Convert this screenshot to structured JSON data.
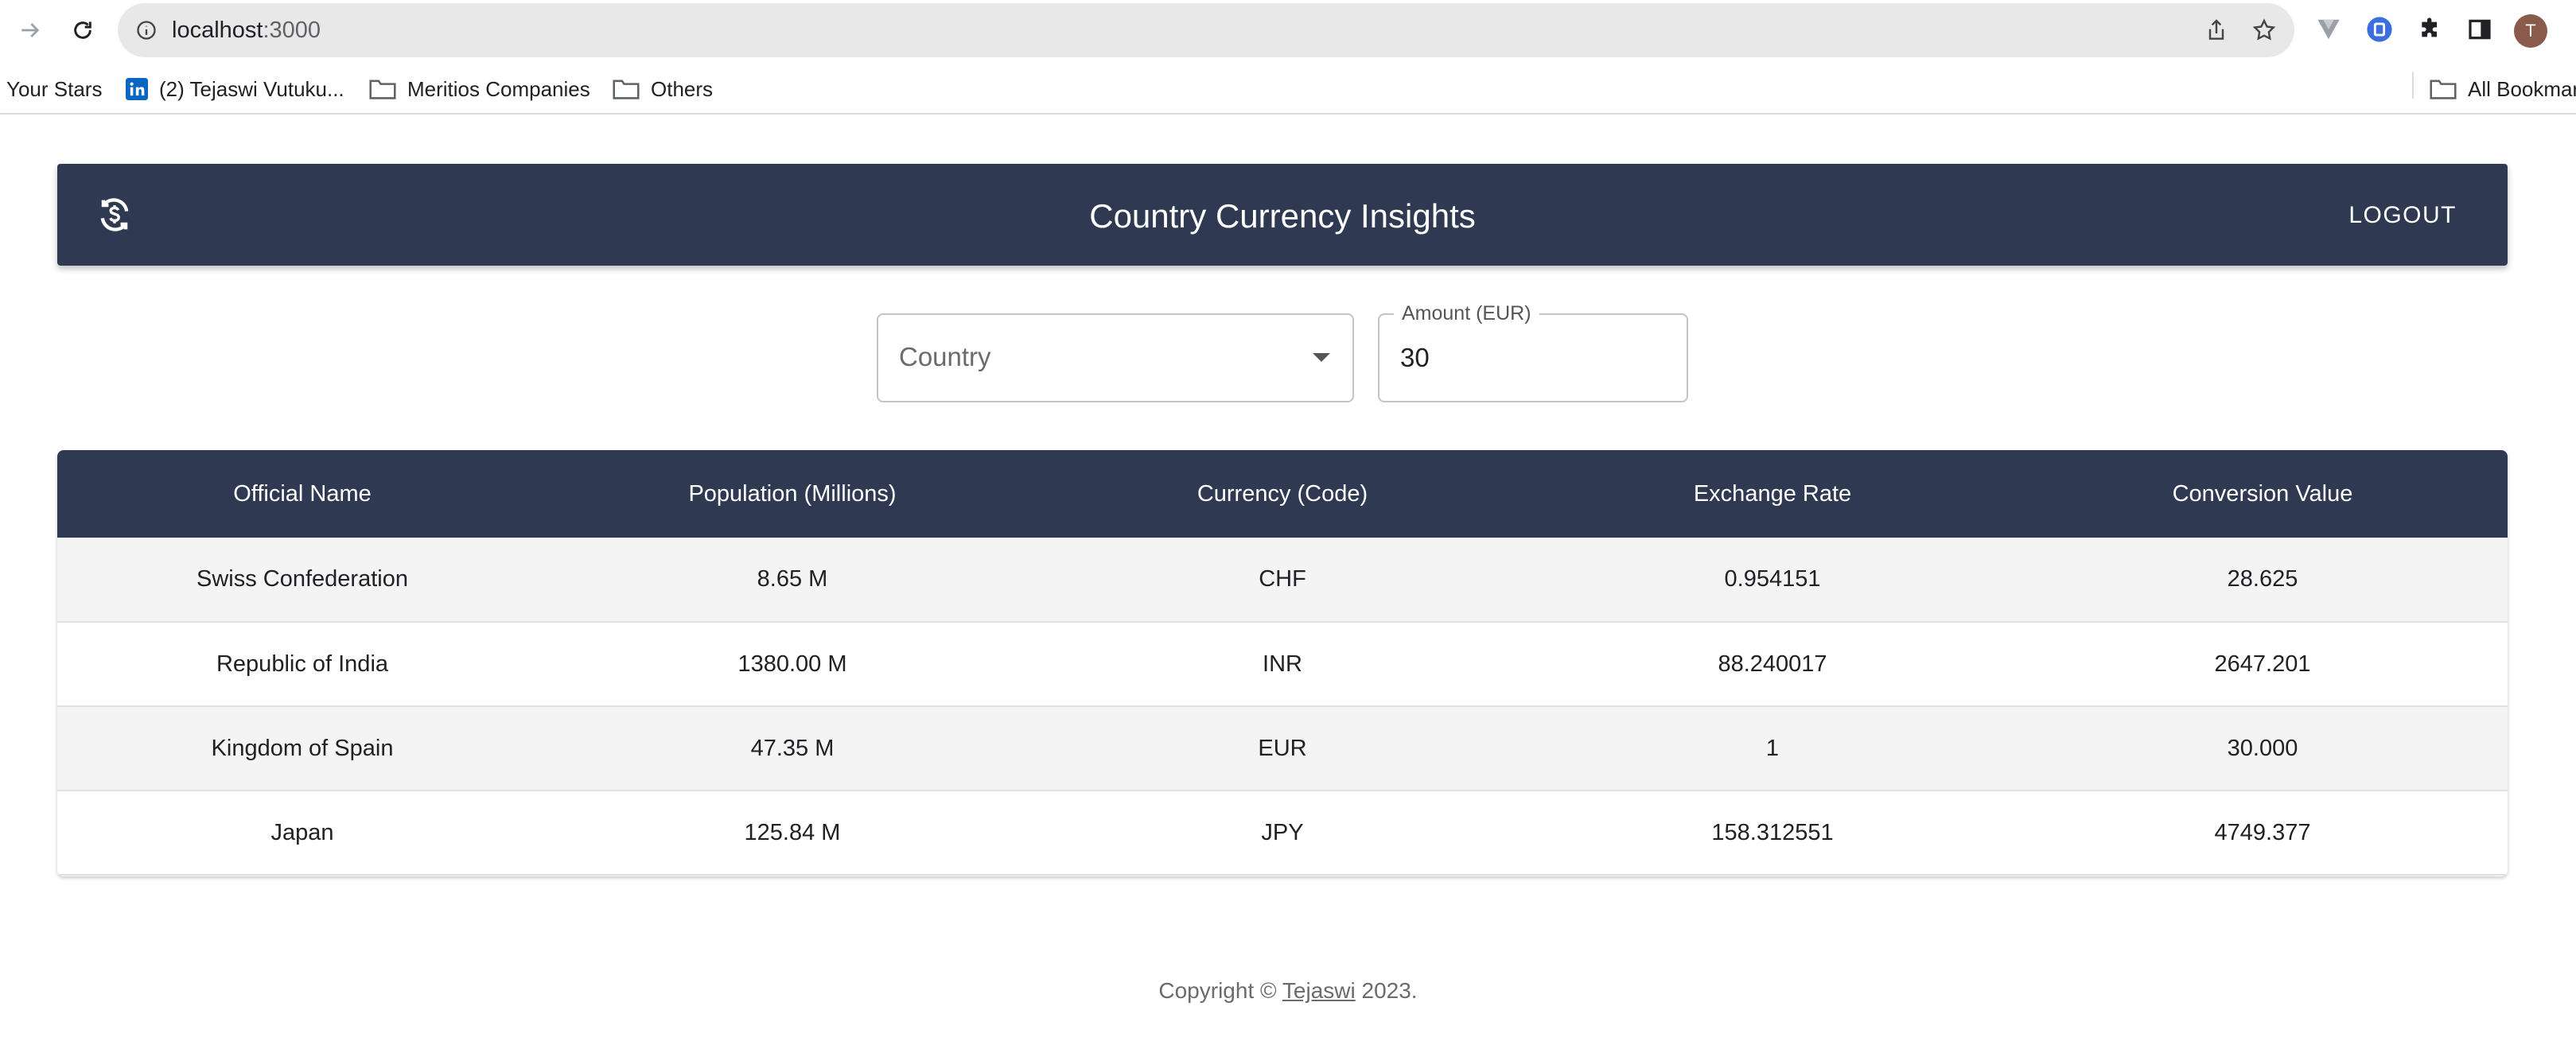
{
  "browser": {
    "url_host": "localhost",
    "url_port": ":3000",
    "bookmarks": [
      {
        "label": "Your Stars",
        "icon": "none"
      },
      {
        "label": "(2) Tejaswi Vutuku...",
        "icon": "linkedin-icon"
      },
      {
        "label": "Meritios Companies",
        "icon": "folder-icon"
      },
      {
        "label": "Others",
        "icon": "folder-icon"
      }
    ],
    "all_bookmarks_label": "All Bookmar",
    "profile_initial": "T"
  },
  "app": {
    "title": "Country Currency Insights",
    "logout_label": "LOGOUT",
    "accent_color": "#2f3a52"
  },
  "filters": {
    "country_placeholder": "Country",
    "amount_label": "Amount (EUR)",
    "amount_value": "30"
  },
  "table": {
    "columns": [
      "Official Name",
      "Population (Millions)",
      "Currency (Code)",
      "Exchange Rate",
      "Conversion Value"
    ],
    "rows": [
      [
        "Swiss Confederation",
        "8.65 M",
        "CHF",
        "0.954151",
        "28.625"
      ],
      [
        "Republic of India",
        "1380.00 M",
        "INR",
        "88.240017",
        "2647.201"
      ],
      [
        "Kingdom of Spain",
        "47.35 M",
        "EUR",
        "1",
        "30.000"
      ],
      [
        "Japan",
        "125.84 M",
        "JPY",
        "158.312551",
        "4749.377"
      ]
    ]
  },
  "footer": {
    "prefix": "Copyright ©",
    "link": "Tejaswi",
    "suffix": "2023."
  }
}
